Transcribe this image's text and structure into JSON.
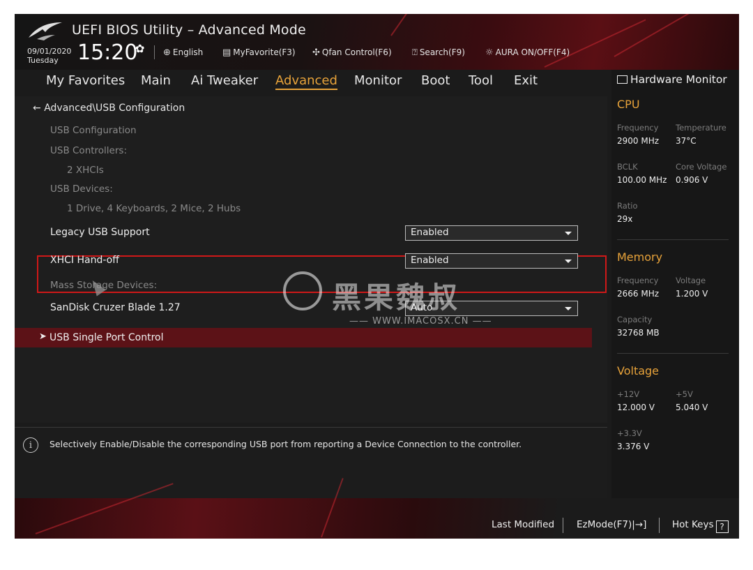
{
  "header": {
    "title": "UEFI BIOS Utility – Advanced Mode",
    "date": "09/01/2020",
    "weekday": "Tuesday",
    "time": "15:20",
    "toolbar": {
      "language": "English",
      "favorite": "MyFavorite(F3)",
      "qfan": "Qfan Control(F6)",
      "search": "Search(F9)",
      "aura": "AURA ON/OFF(F4)"
    }
  },
  "nav": {
    "tabs": [
      "My Favorites",
      "Main",
      "Ai Tweaker",
      "Advanced",
      "Monitor",
      "Boot",
      "Tool",
      "Exit"
    ],
    "active": "Advanced"
  },
  "main": {
    "breadcrumb": "Advanced\\USB Configuration",
    "usb_config_label": "USB Configuration",
    "usb_controllers_label": "USB Controllers:",
    "usb_controllers_value": "2 XHCIs",
    "usb_devices_label": "USB Devices:",
    "usb_devices_value": "1 Drive, 4 Keyboards, 2 Mice, 2 Hubs",
    "legacy_usb_label": "Legacy USB Support",
    "legacy_usb_value": "Enabled",
    "xhci_label": "XHCI Hand-off",
    "xhci_value": "Enabled",
    "mass_storage_label": "Mass Storage Devices:",
    "sandisk_label": "SanDisk Cruzer Blade 1.27",
    "sandisk_value": "Auto",
    "submenu_label": "USB Single Port Control"
  },
  "watermark": {
    "text": "黑果魏叔",
    "url": "—— WWW.IMACOSX.CN ——"
  },
  "info": {
    "text": "Selectively Enable/Disable the corresponding USB port from reporting a Device Connection to the controller."
  },
  "hw_monitor": {
    "title": "Hardware Monitor",
    "cpu": {
      "heading": "CPU",
      "frequency_label": "Frequency",
      "frequency": "2900 MHz",
      "temperature_label": "Temperature",
      "temperature": "37°C",
      "bclk_label": "BCLK",
      "bclk": "100.00 MHz",
      "core_voltage_label": "Core Voltage",
      "core_voltage": "0.906 V",
      "ratio_label": "Ratio",
      "ratio": "29x"
    },
    "memory": {
      "heading": "Memory",
      "frequency_label": "Frequency",
      "frequency": "2666 MHz",
      "voltage_label": "Voltage",
      "voltage": "1.200 V",
      "capacity_label": "Capacity",
      "capacity": "32768 MB"
    },
    "voltage": {
      "heading": "Voltage",
      "v12_label": "+12V",
      "v12": "12.000 V",
      "v5_label": "+5V",
      "v5": "5.040 V",
      "v33_label": "+3.3V",
      "v33": "3.376 V"
    }
  },
  "footer": {
    "last_modified": "Last Modified",
    "ezmode": "EzMode(F7)|",
    "ezmode_icon": "→]",
    "hotkeys": "Hot Keys",
    "hotkeys_icon": "?"
  },
  "colors": {
    "accent": "#e8a33a",
    "highlight_red": "#d01818",
    "submenu_red": "#5c1217"
  }
}
